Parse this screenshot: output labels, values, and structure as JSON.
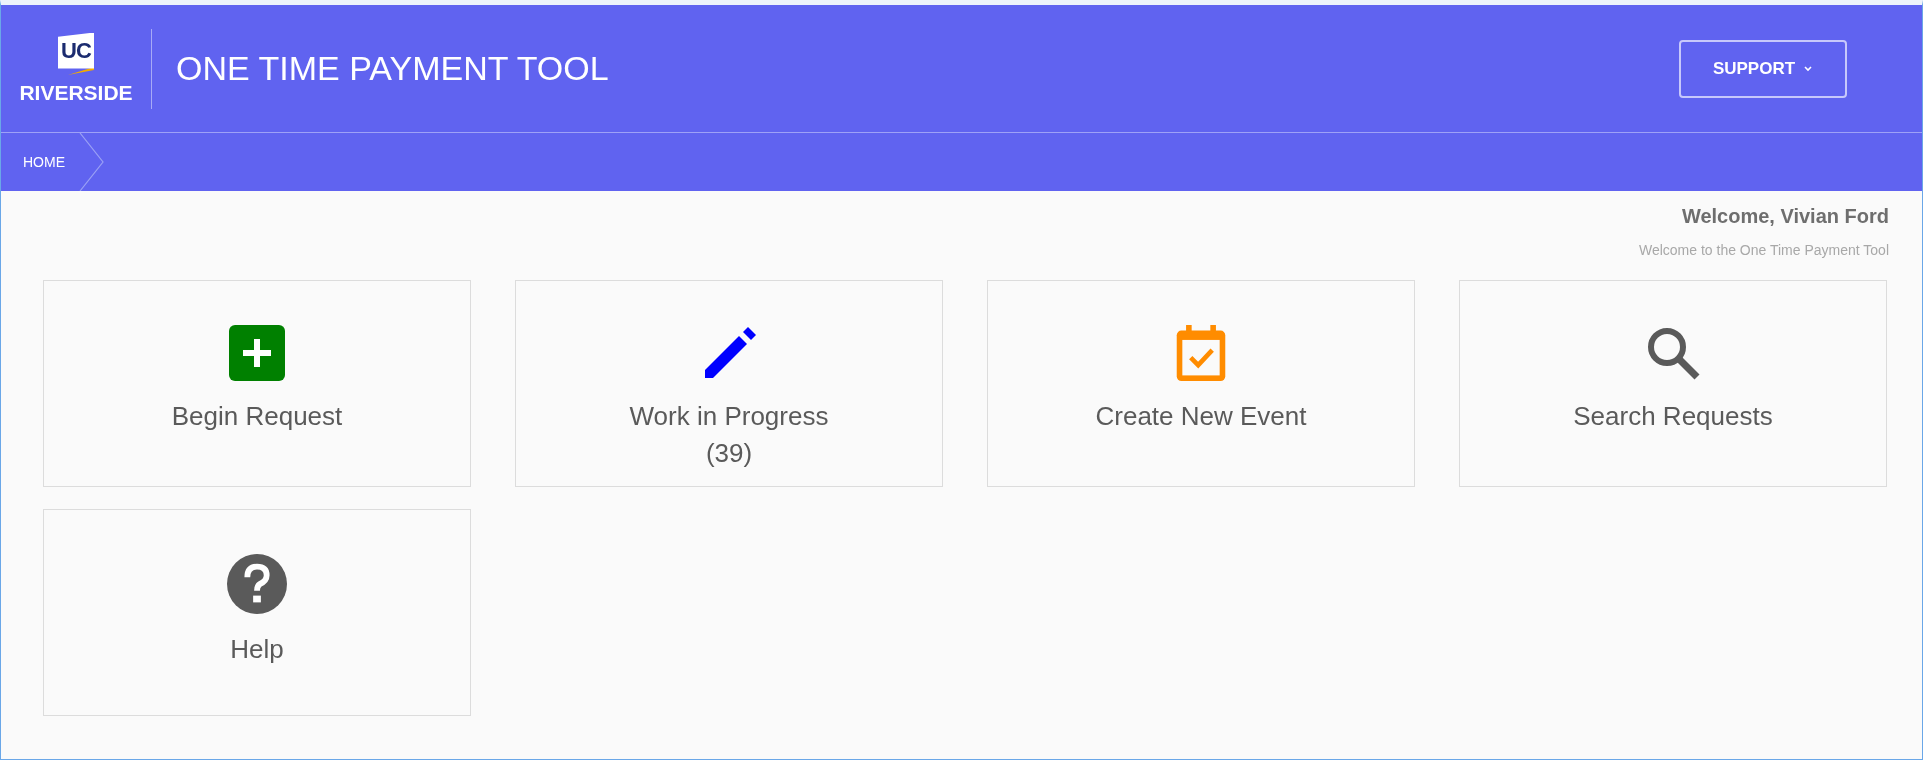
{
  "header": {
    "logo_top": "UC",
    "logo_bottom": "RIVERSIDE",
    "title": "ONE TIME PAYMENT TOOL",
    "support_button": "SUPPORT"
  },
  "breadcrumb": [
    "HOME"
  ],
  "welcome": {
    "greeting": "Welcome, Vivian Ford",
    "subtitle": "Welcome to the One Time Payment Tool"
  },
  "tiles": [
    {
      "kind": "plus",
      "color": "#008000",
      "label": "Begin Request"
    },
    {
      "kind": "pencil",
      "color": "#0000ff",
      "label": "Work in Progress",
      "count": "(39)"
    },
    {
      "kind": "calendar",
      "color": "#ff8c00",
      "label": "Create New Event"
    },
    {
      "kind": "search",
      "color": "#5a5a5a",
      "label": "Search Requests"
    },
    {
      "kind": "help",
      "color": "#5a5a5a",
      "label": "Help"
    }
  ]
}
